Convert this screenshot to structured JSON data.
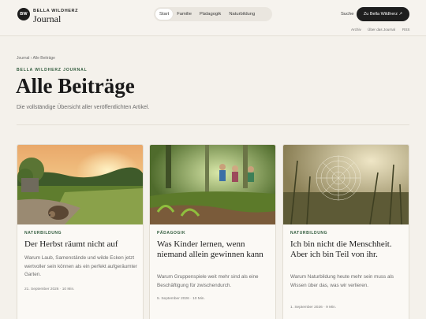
{
  "brand": {
    "mark": "BW",
    "small": "BELLA WILDHERZ",
    "big": "Journal"
  },
  "nav": {
    "items": [
      "Start",
      "Familie",
      "Pädagogik",
      "Naturbildung"
    ],
    "active": 0
  },
  "header": {
    "search": "Suche",
    "cta": "Zu Bella Wildherz ↗"
  },
  "subnav": [
    "Archiv",
    "Über das Journal",
    "RSS"
  ],
  "hero": {
    "breadcrumb": "Journal › Alle Beiträge",
    "eyebrow": "BELLA WILDHERZ JOURNAL",
    "title": "Alle Beiträge",
    "subtitle": "Die vollständige Übersicht aller veröffentlichten Artikel."
  },
  "cards": [
    {
      "image": "hedgehog-garden-sunset",
      "category": "NATURBILDUNG",
      "title": "Der Herbst räumt nicht auf",
      "excerpt": "Warum Laub, Samenstände und wilde Ecken jetzt wertvoller sein können als ein perfekt aufgeräumter Garten.",
      "meta": "21. September 2026 · 10 Min."
    },
    {
      "image": "children-running-forest",
      "category": "PÄDAGOGIK",
      "title": "Was Kinder lernen, wenn niemand allein gewinnen kann",
      "excerpt": "Warum Gruppenspiele weit mehr sind als eine Beschäftigung für zwischendurch.",
      "meta": "5. September 2026 · 10 Min."
    },
    {
      "image": "spiderweb-meadow-dew",
      "category": "NATURBILDUNG",
      "title": "Ich bin nicht die Menschheit. Aber ich bin Teil von ihr.",
      "excerpt": "Warum Naturbildung heute mehr sein muss als Wissen über das, was wir verlieren.",
      "meta": "1. September 2026 · 9 Min."
    }
  ],
  "colors": {
    "accent": "#2f5a3b",
    "background": "#f4f1eb",
    "cta": "#1e1e1e"
  }
}
